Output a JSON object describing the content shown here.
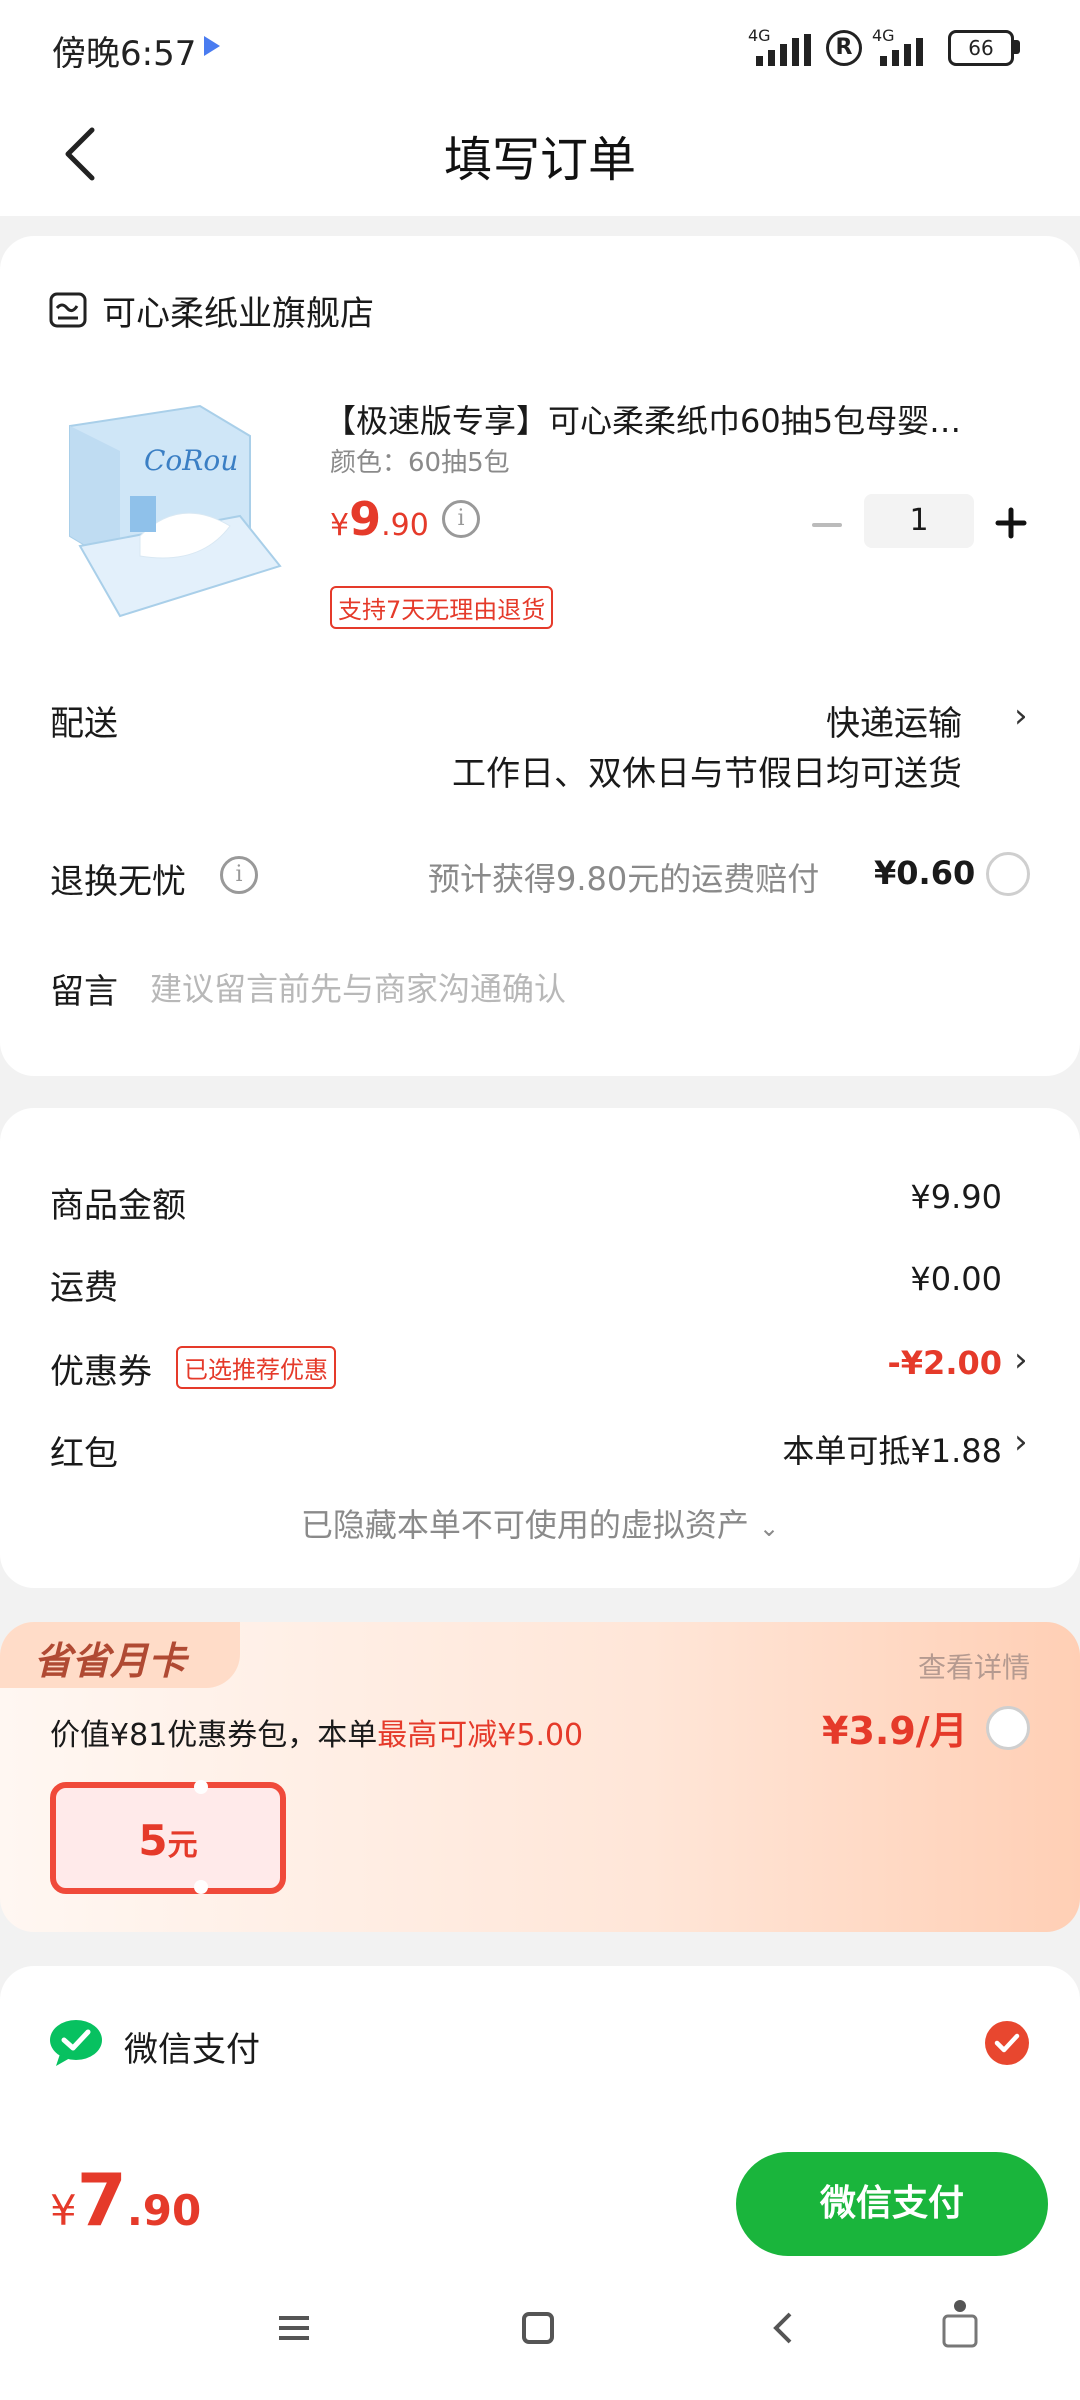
{
  "status_bar": {
    "time": "傍晚6:57",
    "net1": "4G",
    "net2": "4G",
    "r_symbol": "R",
    "battery": "66"
  },
  "header": {
    "title": "填写订单"
  },
  "store": {
    "name": "可心柔纸业旗舰店"
  },
  "product": {
    "image_brand_text": "CoRou",
    "title": "【极速版专享】可心柔柔纸巾60抽5包母婴…",
    "spec": "颜色：60抽5包",
    "price_symbol": "¥",
    "price_int": "9",
    "price_dec": ".90",
    "quantity": "1",
    "return_tag": "支持7天无理由退货"
  },
  "delivery": {
    "label": "配送",
    "method": "快递运输",
    "note": "工作日、双休日与节假日均可送货"
  },
  "return_worry": {
    "label": "退换无忧",
    "desc": "预计获得9.80元的运费赔付",
    "price": "¥0.60"
  },
  "message": {
    "label": "留言",
    "placeholder": "建议留言前先与商家沟通确认"
  },
  "summary": {
    "goods_label": "商品金额",
    "goods_value": "¥9.90",
    "shipping_label": "运费",
    "shipping_value": "¥0.00",
    "coupon_label": "优惠券",
    "coupon_tag": "已选推荐优惠",
    "coupon_value": "-¥2.00",
    "redpacket_label": "红包",
    "redpacket_value": "本单可抵¥1.88",
    "hidden_assets": "已隐藏本单不可使用的虚拟资产"
  },
  "monthly_card": {
    "badge": "省省月卡",
    "detail_link": "查看详情",
    "desc_prefix": "价值¥81优惠券包，本单",
    "desc_highlight": "最高可减¥5.00",
    "price": "¥3.9/月",
    "coupon_amount": "5",
    "coupon_unit": "元"
  },
  "payment": {
    "method": "微信支付"
  },
  "footer": {
    "total_symbol": "¥",
    "total_int": "7",
    "total_dec": ".90",
    "pay_button": "微信支付"
  },
  "colors": {
    "accent_red": "#e53a2a",
    "wechat_green": "#07c160",
    "pay_button": "#1ab53c"
  }
}
